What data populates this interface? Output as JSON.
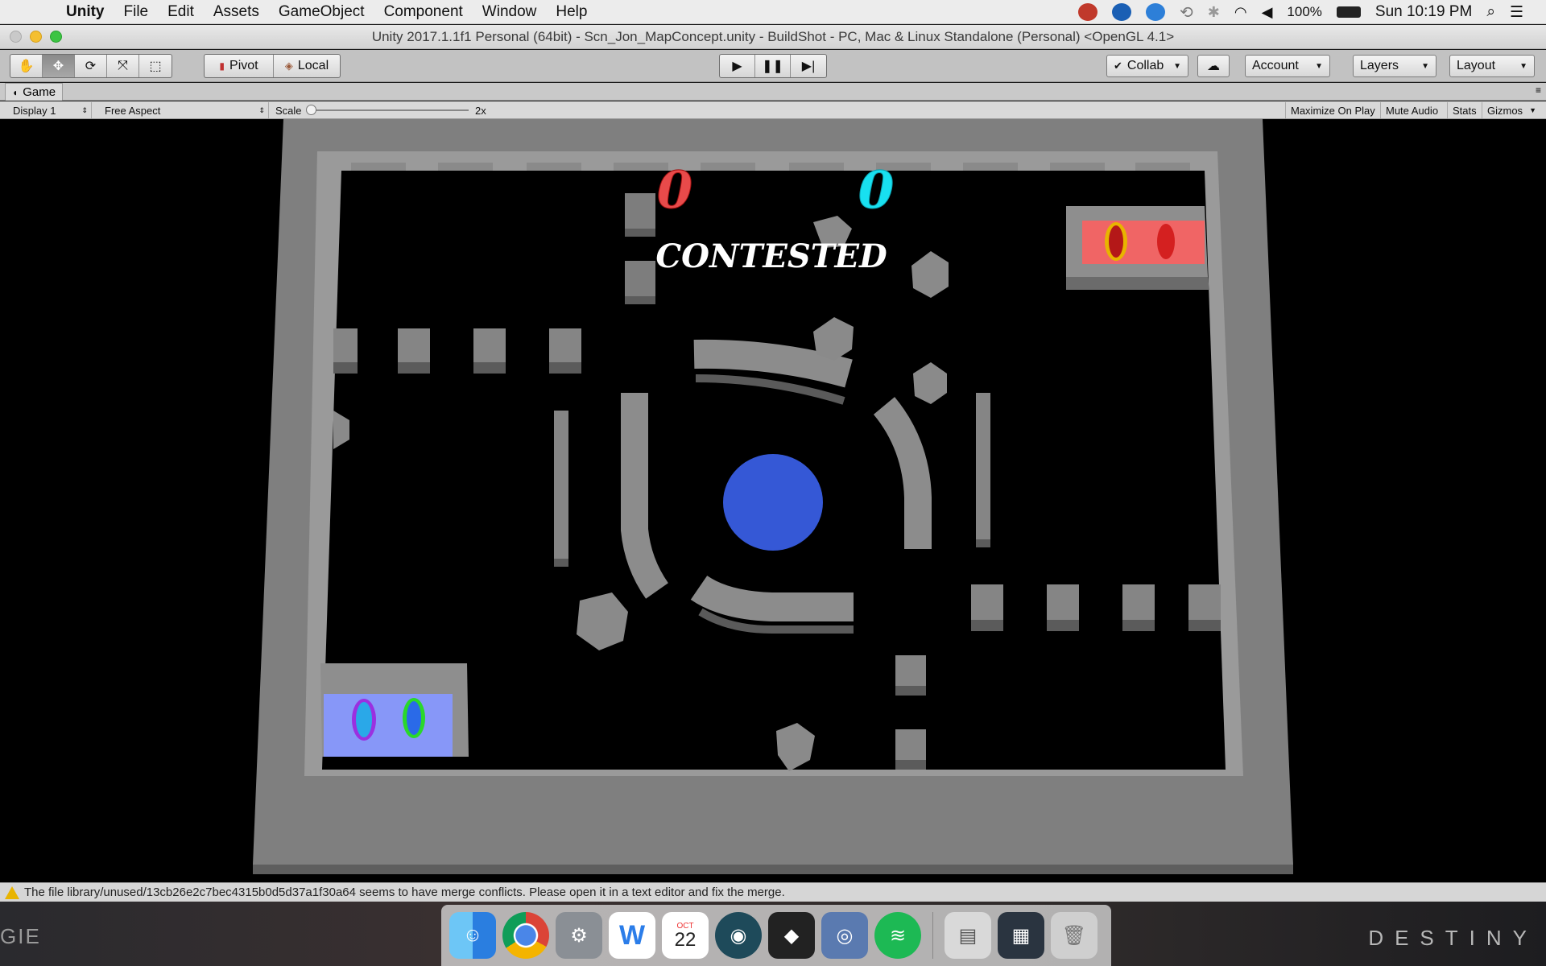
{
  "menubar": {
    "app_name": "Unity",
    "items": [
      "File",
      "Edit",
      "Assets",
      "GameObject",
      "Component",
      "Window",
      "Help"
    ],
    "battery": "100%",
    "clock": "Sun 10:19 PM"
  },
  "window": {
    "title": "Unity 2017.1.1f1 Personal (64bit) - Scn_Jon_MapConcept.unity - BuildShot - PC, Mac & Linux Standalone (Personal) <OpenGL 4.1>"
  },
  "toolbar": {
    "pivot_label": "Pivot",
    "local_label": "Local",
    "collab_label": "Collab",
    "account_label": "Account",
    "layers_label": "Layers",
    "layout_label": "Layout"
  },
  "game_view": {
    "tab_label": "Game",
    "display": "Display 1",
    "aspect": "Free Aspect",
    "scale_label": "Scale",
    "scale_value": "2x",
    "maximize_label": "Maximize On Play",
    "mute_label": "Mute Audio",
    "stats_label": "Stats",
    "gizmos_label": "Gizmos"
  },
  "hud": {
    "red_score": "0",
    "cyan_score": "0",
    "status_text": "CONTESTED"
  },
  "console": {
    "message": "The file library/unused/13cb26e2c7bec4315b0d5d37a1f30a64 seems to have merge conflicts. Please open it in a text editor and fix the merge."
  },
  "dock": {
    "calendar_month": "OCT",
    "calendar_day": "22"
  },
  "desktop": {
    "left_text": "GIE",
    "right_text": "DESTINY"
  },
  "colors": {
    "red_team": "#e84a4a",
    "cyan_team": "#18e0f0",
    "capture_point": "#3558d6",
    "red_base": "#f06565",
    "blue_base": "#8797f8",
    "wall": "#8a8a8a"
  }
}
